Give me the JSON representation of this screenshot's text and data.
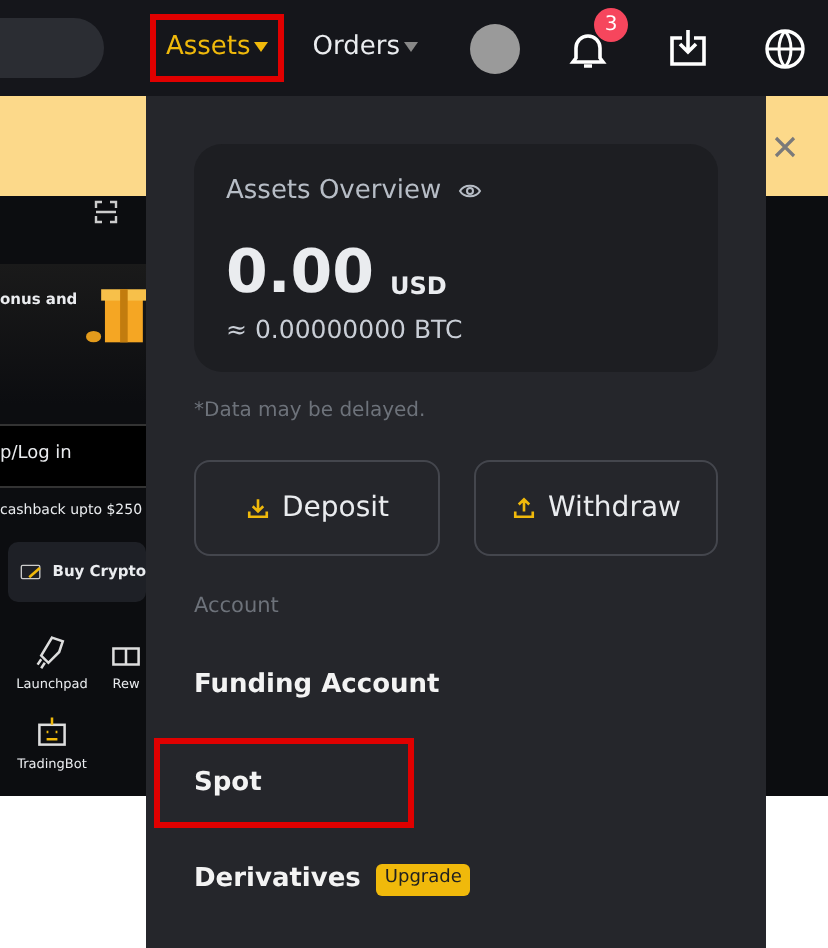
{
  "nav": {
    "items": [
      {
        "label": "Assets",
        "selected": true,
        "highlighted": true
      },
      {
        "label": "Orders",
        "selected": false,
        "highlighted": false
      }
    ],
    "notification_count": "3"
  },
  "background_page": {
    "promo_text": "onus and",
    "login": "p/Log in",
    "cashback": "cashback upto $250",
    "buy_button": "Buy Crypto",
    "shortcuts": [
      {
        "label": "Launchpad",
        "kind": "rocket"
      },
      {
        "label": "Rew",
        "kind": "gift"
      },
      {
        "label": "TradingBot",
        "kind": "bot"
      }
    ]
  },
  "dropdown": {
    "title": "Assets Overview",
    "amount": "0.00",
    "currency": "USD",
    "btc": "≈ 0.00000000 BTC",
    "note": "*Data may be delayed.",
    "buttons": [
      {
        "label": "Deposit",
        "kind": "deposit"
      },
      {
        "label": "Withdraw",
        "kind": "withdraw"
      }
    ],
    "section": "Account",
    "accounts": [
      {
        "label": "Funding Account",
        "highlighted": false
      },
      {
        "label": "Spot",
        "highlighted": true
      },
      {
        "label": "Derivatives",
        "badge": "Upgrade",
        "highlighted": false
      }
    ]
  }
}
